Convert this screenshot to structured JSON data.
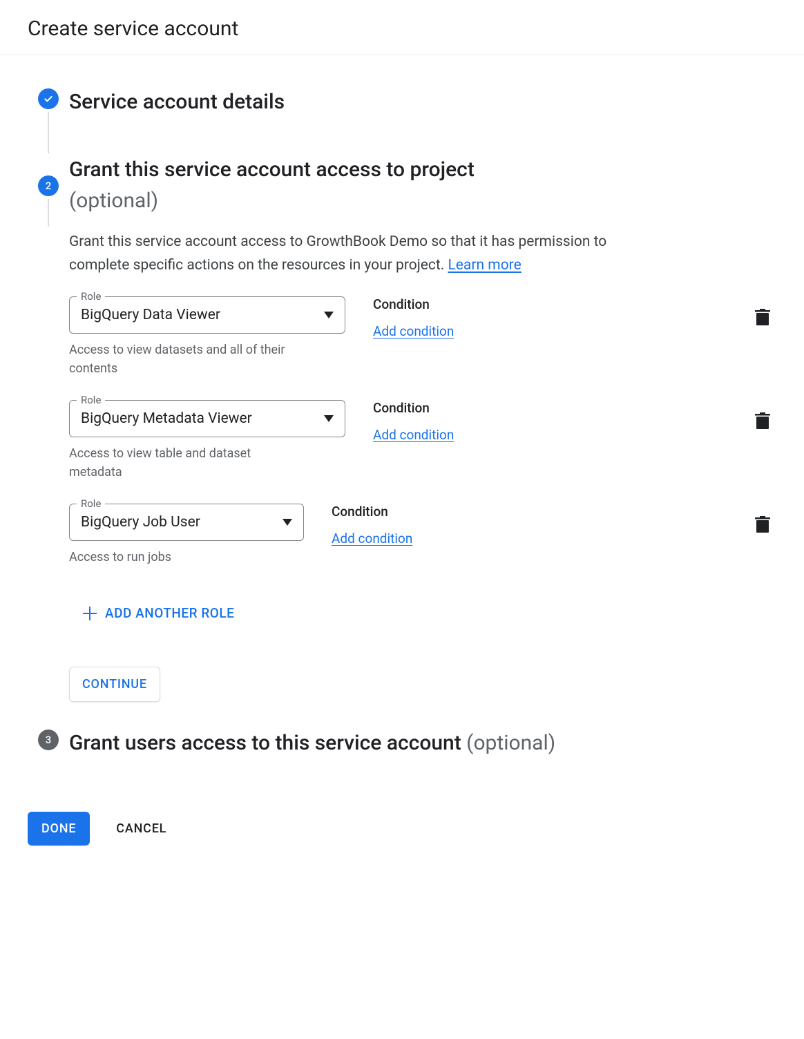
{
  "header": {
    "title": "Create service account"
  },
  "steps": {
    "step1": {
      "title": "Service account details"
    },
    "step2": {
      "number": "2",
      "title": "Grant this service account access to project",
      "subtitle": "(optional)",
      "description": "Grant this service account access to GrowthBook Demo so that it has permission to complete specific actions on the resources in your project. ",
      "learn_more": "Learn more"
    },
    "step3": {
      "number": "3",
      "title": "Grant users access to this service account ",
      "subtitle": "(optional)"
    }
  },
  "role_field_label": "Role",
  "condition_label": "Condition",
  "add_condition_label": "Add condition",
  "roles": [
    {
      "value": "BigQuery Data Viewer",
      "help": "Access to view datasets and all of their contents"
    },
    {
      "value": "BigQuery Metadata Viewer",
      "help": "Access to view table and dataset metadata"
    },
    {
      "value": "BigQuery Job User",
      "help": "Access to run jobs"
    }
  ],
  "add_role_label": "ADD ANOTHER ROLE",
  "continue_label": "CONTINUE",
  "footer": {
    "done": "DONE",
    "cancel": "CANCEL"
  }
}
